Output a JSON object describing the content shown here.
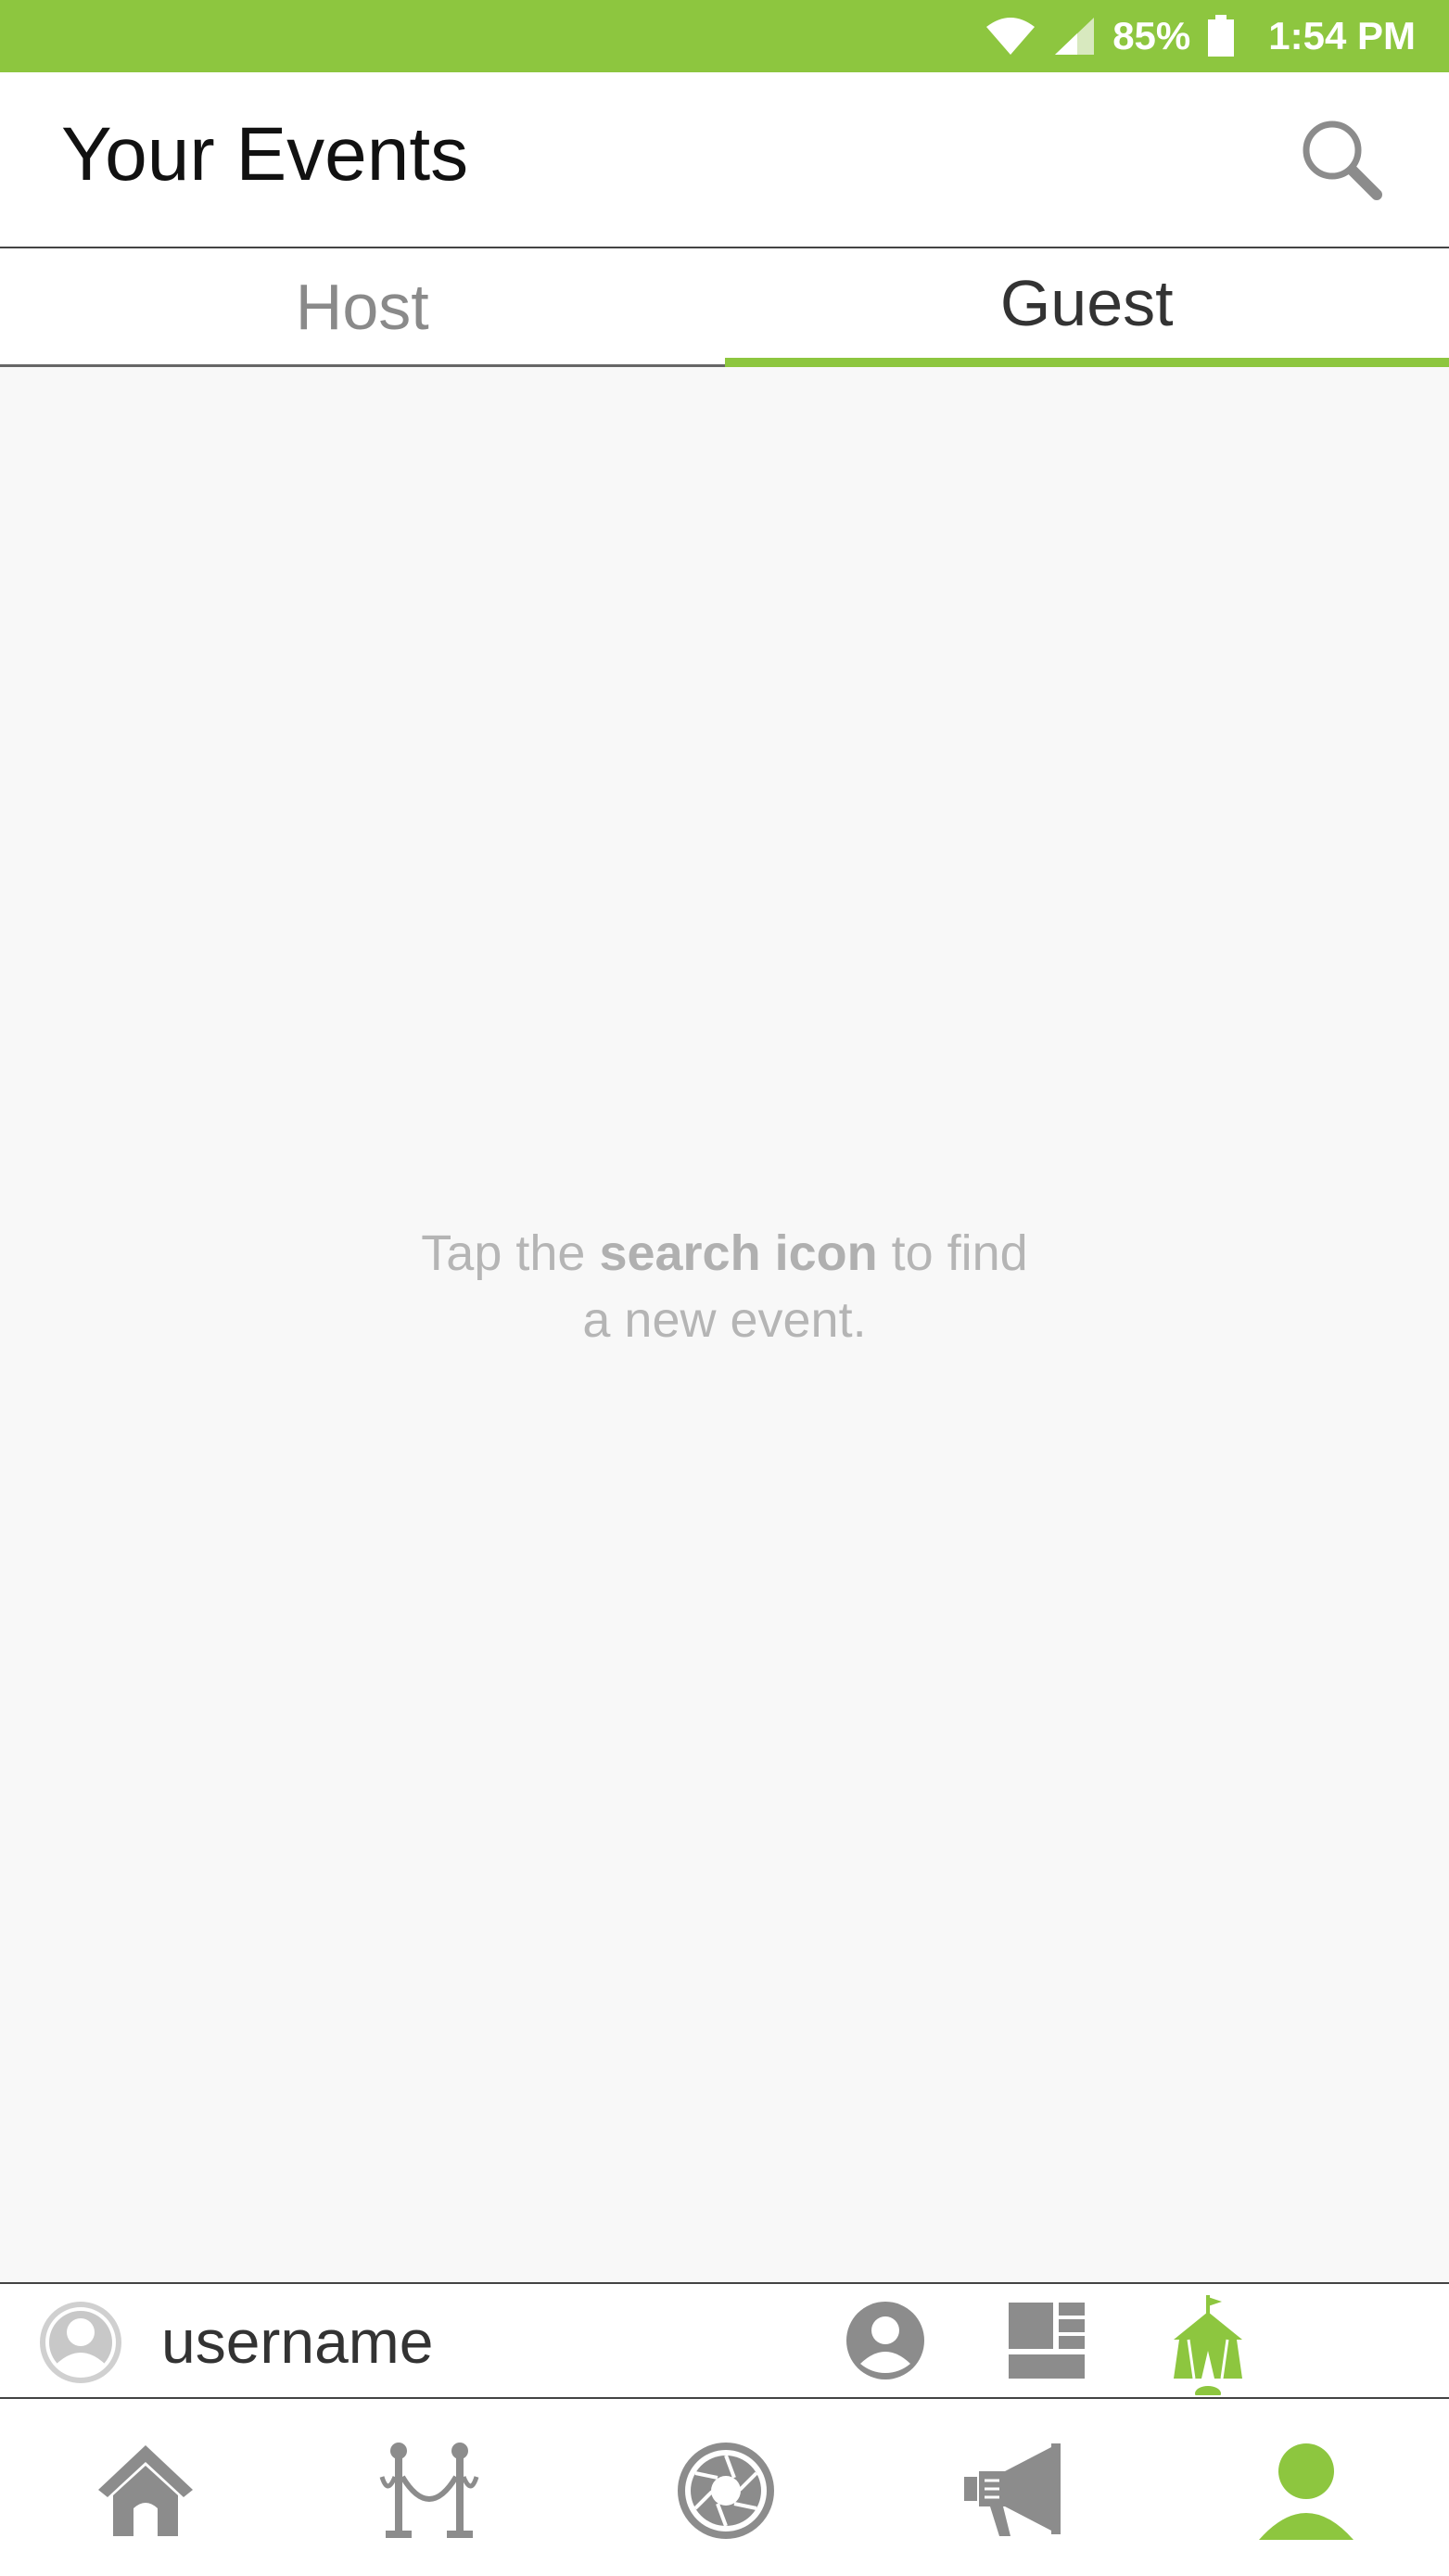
{
  "status_bar": {
    "battery": "85%",
    "time": "1:54 PM"
  },
  "header": {
    "title": "Your Events",
    "search_icon": "search-icon"
  },
  "tabs": [
    {
      "label": "Host",
      "active": false
    },
    {
      "label": "Guest",
      "active": true
    }
  ],
  "empty_state": {
    "text_before": "Tap the ",
    "text_bold": "search icon",
    "text_after": " to find",
    "line2": "a new event."
  },
  "user_bar": {
    "username": "username",
    "icons": [
      "profile-icon",
      "layout-grid-icon",
      "tent-icon"
    ]
  },
  "bottom_nav": {
    "items": [
      "home-icon",
      "velvet-rope-icon",
      "camera-aperture-icon",
      "megaphone-icon",
      "person-icon"
    ],
    "active": "person-icon"
  },
  "colors": {
    "accent": "#8dc63f",
    "icon_gray": "#8c8c8c"
  }
}
